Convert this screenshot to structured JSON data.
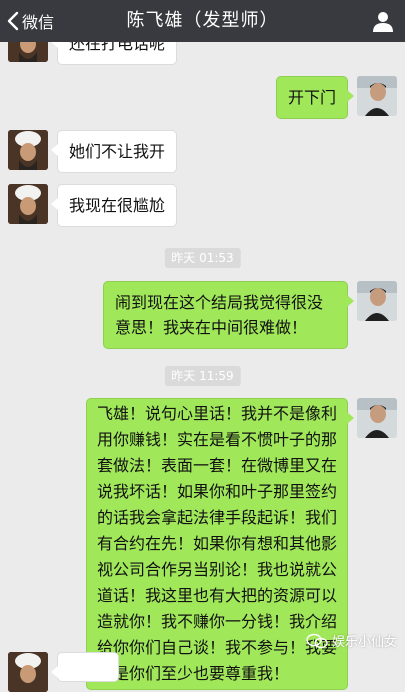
{
  "colors": {
    "nav_bg": "#393a3f",
    "chat_bg": "#ebebeb",
    "sent_bubble": "#a0e75a",
    "received_bubble": "#ffffff"
  },
  "nav": {
    "back_label": "微信",
    "title": "陈飞雄（发型师）",
    "back_icon": "chevron-left-icon",
    "profile_icon": "person-icon"
  },
  "messages": [
    {
      "side": "left",
      "text": "还在打电话呢"
    },
    {
      "side": "right",
      "text": "开下门"
    },
    {
      "side": "left",
      "text": "她们不让我开"
    },
    {
      "side": "left",
      "text": "我现在很尴尬"
    },
    {
      "side": "right",
      "text": "闹到现在这个结局我觉得很没意思！我夹在中间很难做！"
    },
    {
      "side": "right",
      "text": "飞雄！说句心里话！我并不是像利用你赚钱！实在是看不惯叶子的那套做法！表面一套！在微博里又在说我坏话！如果你和叶子那里签约的话我会拿起法律手段起诉！我们有合约在先！如果你有想和其他影视公司合作另当别论！我也说就公道话！我这里也有大把的资源可以造就你！我不赚你一分钱！我介绍给你你们自己谈！我不参与！我要的是你们至少也要尊重我！"
    }
  ],
  "timestamps": [
    "昨天 01:53",
    "昨天 11:59"
  ],
  "watermark": "娱乐小仙女"
}
